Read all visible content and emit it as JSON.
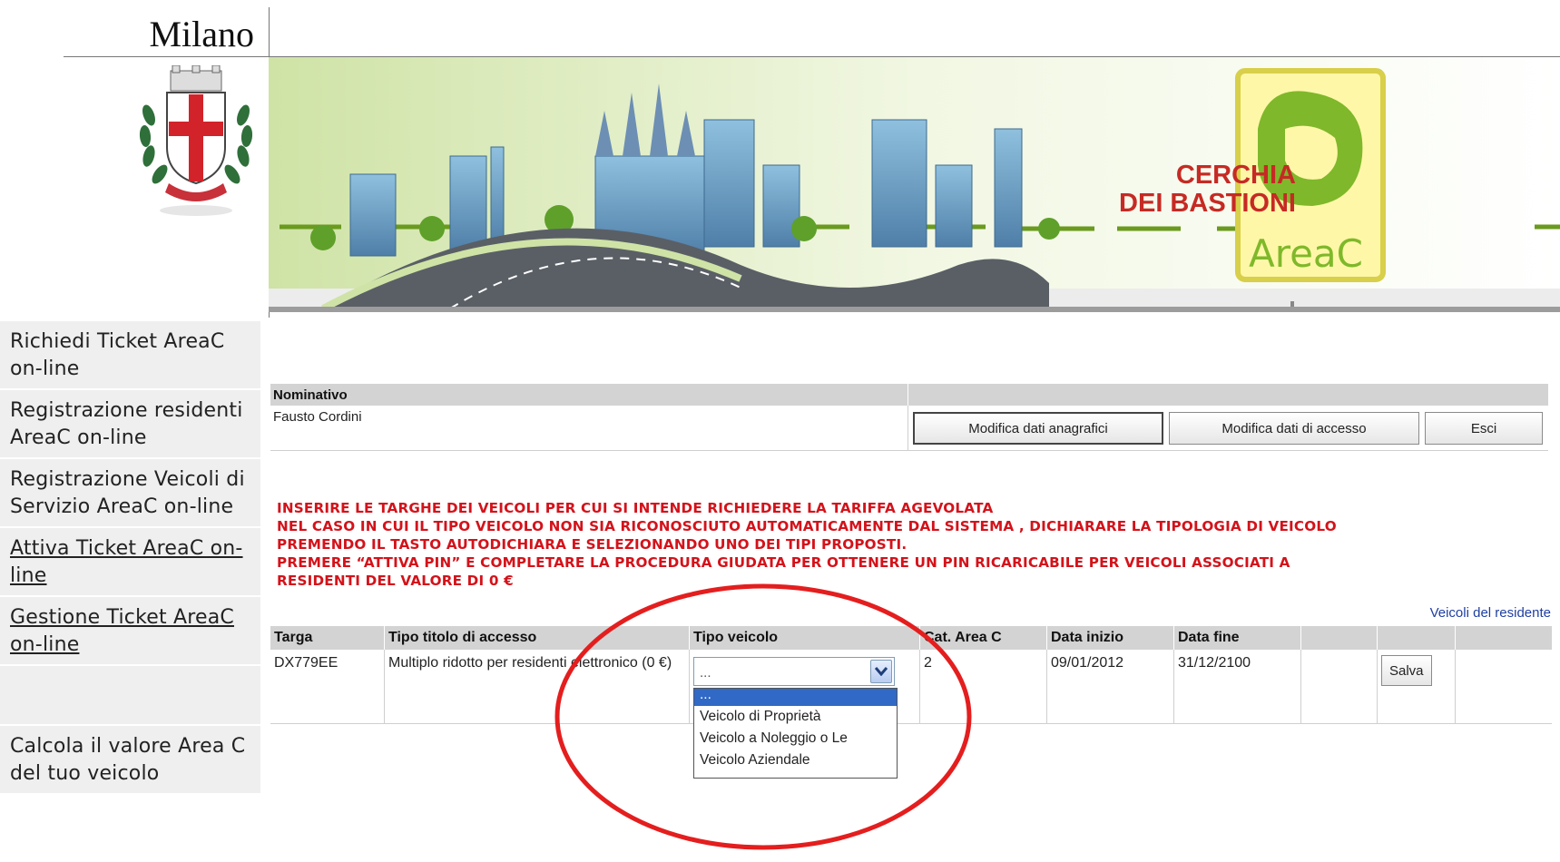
{
  "brand": "Milano",
  "banner": {
    "cerchia_line1": "CERCHIA",
    "cerchia_line2": "DEI BASTIONI",
    "sign_text": "AreaC"
  },
  "nav": [
    {
      "label": "Richiedi Ticket AreaC on-line",
      "underline": false
    },
    {
      "label": "Registrazione residenti AreaC on-line",
      "underline": false
    },
    {
      "label": "Registrazione Veicoli di Servizio AreaC on-line",
      "underline": false
    },
    {
      "label": "Attiva Ticket AreaC on-line",
      "underline": true
    },
    {
      "label": "Gestione Ticket AreaC on-line",
      "underline": true
    },
    {
      "label": "",
      "underline": false
    },
    {
      "label": "Calcola il valore Area C del tuo veicolo",
      "underline": false
    }
  ],
  "user": {
    "header_label": "Nominativo",
    "name": "Fausto Cordini",
    "buttons": {
      "edit_personal": "Modifica dati anagrafici",
      "edit_access": "Modifica dati di accesso",
      "exit": "Esci"
    }
  },
  "instructions": [
    "INSERIRE LE TARGHE DEI VEICOLI PER CUI SI INTENDE RICHIEDERE LA TARIFFA AGEVOLATA",
    "NEL CASO IN CUI IL TIPO VEICOLO NON SIA RICONOSCIUTO AUTOMATICAMENTE DAL SISTEMA , DICHIARARE LA TIPOLOGIA DI VEICOLO",
    "PREMENDO IL TASTO AUTODICHIARA E SELEZIONANDO UNO DEI TIPI PROPOSTI.",
    "PREMERE “ATTIVA PIN” E COMPLETARE LA PROCEDURA GIUDATA PER OTTENERE UN PIN RICARICABILE PER VEICOLI ASSOCIATI A",
    "RESIDENTI DEL VALORE DI 0 €"
  ],
  "vehicles_link": "Veicoli del residente",
  "vehicles_table": {
    "columns": [
      "Targa",
      "Tipo titolo di accesso",
      "Tipo veicolo",
      "Cat. Area C",
      "Data inizio",
      "Data fine",
      "",
      ""
    ],
    "row": {
      "targa": "DX779EE",
      "tipo_titolo": "Multiplo ridotto per residenti elettronico (0 €)",
      "tipo_veicolo_selected": "...",
      "cat_area_c": "2",
      "data_inizio": "09/01/2012",
      "data_fine": "31/12/2100",
      "save_label": "Salva"
    }
  },
  "dropdown_options": [
    "...",
    "Veicolo di Proprietà",
    "Veicolo a Noleggio o Le",
    "Veicolo Aziendale"
  ],
  "colors": {
    "instruction_red": "#d4121a",
    "banner_green": "#7fb82a",
    "highlight_circle": "#e41e1e",
    "selected_option": "#3169c6"
  }
}
